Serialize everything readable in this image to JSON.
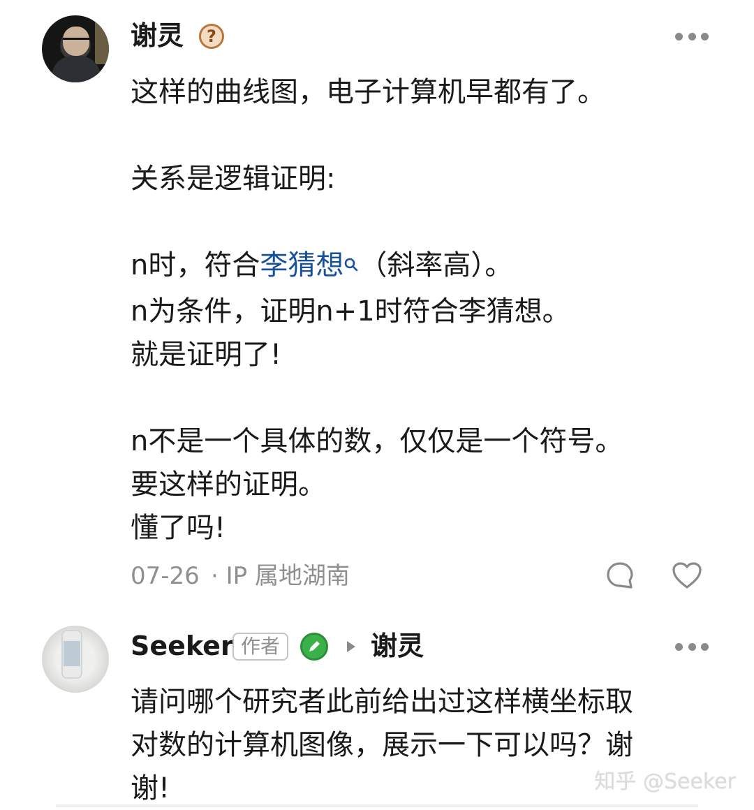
{
  "comments": [
    {
      "username": "谢灵",
      "help_badge": "?",
      "lines": [
        "这样的曲线图，电子计算机早都有了。",
        "",
        "关系是逻辑证明:",
        "",
        "n时，符合",
        "n为条件，证明n+1时符合李猜想。",
        "就是证明了!",
        "",
        "n不是一个具体的数，仅仅是一个符号。",
        "要这样的证明。",
        "懂了吗!"
      ],
      "link_text": "李猜想",
      "link_after": "（斜率高）。",
      "date": "07-26",
      "location": "· IP 属地湖南"
    },
    {
      "username": "Seeker",
      "author_tag": "作者",
      "reply_to": "谢灵",
      "lines": [
        "请问哪个研究者此前给出过这样横坐标取",
        "对数的计算机图像，展示一下可以吗？谢",
        "谢!"
      ]
    }
  ],
  "watermark": "知乎 @Seeker",
  "icons": {
    "more": "more-dots-icon",
    "search": "search-icon",
    "reply": "reply-bubble-icon",
    "like": "heart-icon",
    "verified": "pen-badge-icon",
    "reply_arrow": "triangle-arrow-icon"
  },
  "colors": {
    "link": "#175199",
    "meta": "#8f8f8f",
    "text": "#1a1a1a"
  }
}
